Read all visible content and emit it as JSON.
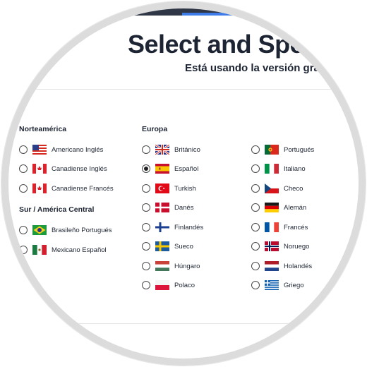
{
  "header": {
    "title": "Select and Speak",
    "subtitle": "Está usando la versión gratuita"
  },
  "regions": {
    "norteamerica": "Norteamérica",
    "sur_america": "Sur / América Central",
    "europa": "Europa"
  },
  "voices": {
    "americano_ingles": "Americano Inglés",
    "canadiense_ingles": "Canadiense Inglés",
    "canadiense_frances": "Canadiense Francés",
    "brasileno_portugues": "Brasileño Portugués",
    "mexicano_espanol": "Mexicano Español",
    "britanico": "Británico",
    "espanol": "Español",
    "turkish": "Turkish",
    "danes": "Danés",
    "finlandes": "Finlandés",
    "sueco": "Sueco",
    "hungaro": "Húngaro",
    "polaco": "Polaco",
    "portugues": "Portugués",
    "italiano": "Italiano",
    "checo": "Checo",
    "aleman": "Alemán",
    "frances": "Francés",
    "noruego": "Noruego",
    "holandes": "Holandés",
    "griego": "Griego"
  },
  "selected_voice": "Español",
  "colors": {
    "title": "#1d2433",
    "topbar": "#2f3746",
    "accent": "#3d7ce8"
  }
}
